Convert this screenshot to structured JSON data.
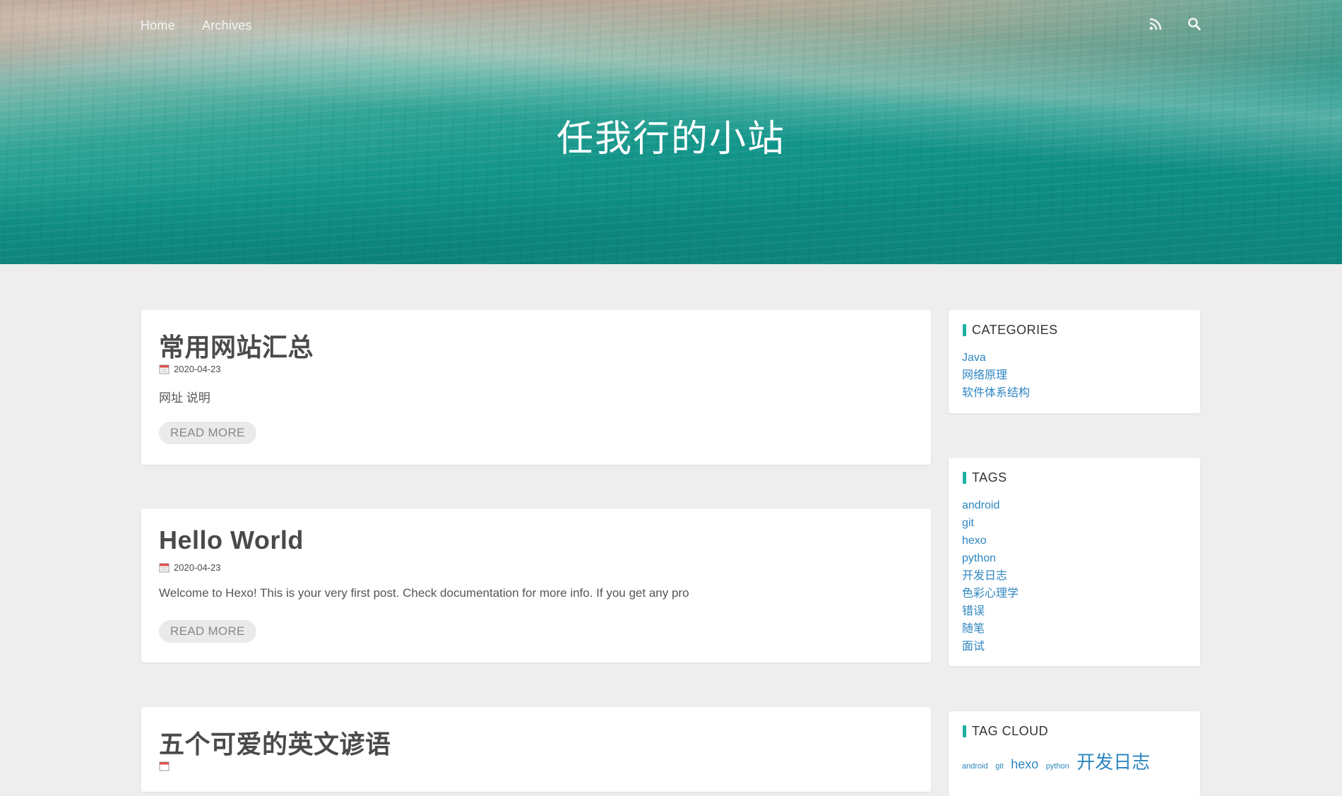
{
  "nav": {
    "home": "Home",
    "archives": "Archives"
  },
  "header": {
    "site_title": "任我行的小站",
    "icons": [
      "rss-icon",
      "search-icon"
    ]
  },
  "posts": [
    {
      "title": "常用网站汇总",
      "date": "2020-04-23",
      "excerpt": "网址 说明",
      "read_more": "READ MORE"
    },
    {
      "title": "Hello World",
      "date": "2020-04-23",
      "excerpt": "Welcome to Hexo! This is your very first post. Check documentation for more info. If you get any pro",
      "read_more": "READ MORE"
    },
    {
      "title": "五个可爱的英文谚语",
      "date": "",
      "excerpt": "",
      "read_more": ""
    }
  ],
  "sidebar": {
    "categories": {
      "title": "CATEGORIES",
      "items": [
        "Java",
        "网络原理",
        "软件体系结构"
      ]
    },
    "tags": {
      "title": "TAGS",
      "items": [
        "android",
        "git",
        "hexo",
        "python",
        "开发日志",
        "色彩心理学",
        "错误",
        "随笔",
        "面试"
      ]
    },
    "tag_cloud": {
      "title": "TAG CLOUD",
      "items": [
        "android",
        "git",
        "hexo",
        "python",
        "开发日志"
      ]
    }
  },
  "colors": {
    "accent": "#1fb0a0",
    "link": "#2e86c1",
    "background": "#eeeeee"
  }
}
